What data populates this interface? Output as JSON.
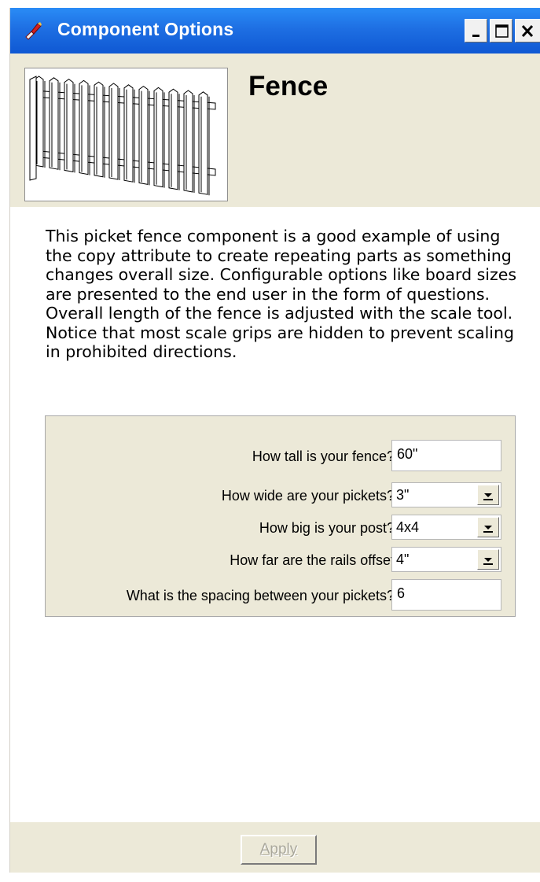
{
  "window": {
    "title": "Component Options",
    "controls": {
      "minimize": "minimize",
      "maximize": "maximize",
      "close": "close"
    }
  },
  "component": {
    "name": "Fence",
    "thumbnail_icon": "picket-fence-thumbnail",
    "description": "This picket fence component is a good example of using the copy attribute to create repeating parts as something changes overall size. Configurable options like board sizes are presented to the end user in the form of questions. Overall length of the fence is adjusted with the scale tool. Notice that most scale grips are hidden to prevent scaling in prohibited directions."
  },
  "options": {
    "rows": [
      {
        "label": "How tall is your fence?",
        "value": "60\"",
        "type": "text"
      },
      {
        "label": "How wide are your pickets?",
        "value": "3\"",
        "type": "select"
      },
      {
        "label": "How big is your post?",
        "value": "4x4",
        "type": "select"
      },
      {
        "label": "How far are the rails offset",
        "value": "4\"",
        "type": "select"
      },
      {
        "label": "What is the spacing between your pickets?",
        "value": "6",
        "type": "text"
      }
    ]
  },
  "footer": {
    "apply_label": "Apply",
    "apply_enabled": false
  },
  "colors": {
    "titlebar": "#1e6fe3",
    "panel_bg": "#ece9d8",
    "disabled_text": "#a9a79a"
  }
}
